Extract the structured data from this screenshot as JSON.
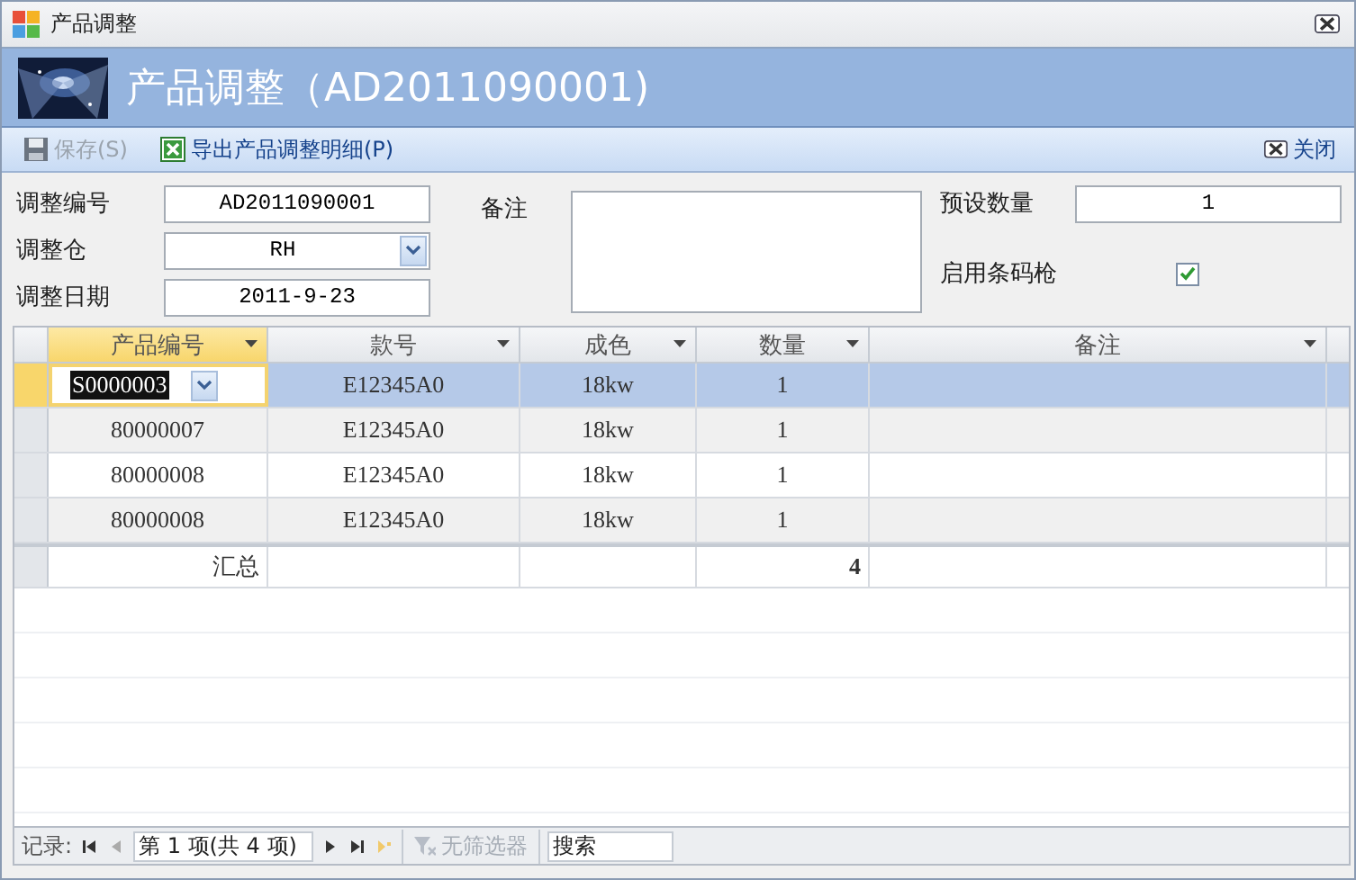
{
  "window": {
    "title": "产品调整"
  },
  "header": {
    "title": "产品调整（AD2011090001)"
  },
  "toolbar": {
    "buttons": [
      {
        "kind": "save",
        "label": "保存(S)",
        "disabled": true
      },
      {
        "kind": "export",
        "label": "导出产品调整明细(P)",
        "disabled": false
      },
      {
        "kind": "close",
        "label": "关闭",
        "disabled": false
      }
    ]
  },
  "form": {
    "number": {
      "label": "调整编号",
      "value": "AD2011090001"
    },
    "warehouse": {
      "label": "调整仓",
      "value": "RH"
    },
    "date": {
      "label": "调整日期",
      "value": "2011-9-23"
    },
    "note": {
      "label": "备注"
    },
    "preset_qty": {
      "label": "预设数量",
      "value": "1"
    },
    "barcode": {
      "label": "启用条码枪",
      "checked": true
    }
  },
  "table": {
    "columns": [
      {
        "label": "产品编号",
        "selected": true
      },
      {
        "label": "款号",
        "selected": false
      },
      {
        "label": "成色",
        "selected": false
      },
      {
        "label": "数量",
        "selected": false
      },
      {
        "label": "备注",
        "selected": false
      }
    ],
    "rows": [
      {
        "selected": true,
        "cells": [
          "S0000003",
          "E12345A0",
          "18kw",
          "1",
          ""
        ]
      },
      {
        "selected": false,
        "cells": [
          "80000007",
          "E12345A0",
          "18kw",
          "1",
          ""
        ]
      },
      {
        "selected": false,
        "cells": [
          "80000008",
          "E12345A0",
          "18kw",
          "1",
          ""
        ]
      },
      {
        "selected": false,
        "cells": [
          "80000008",
          "E12345A0",
          "18kw",
          "1",
          ""
        ]
      }
    ],
    "total": {
      "label": "汇总",
      "quantity": "4"
    }
  },
  "navigator": {
    "label": "记录:",
    "position": "第 1 项(共 4 项)",
    "filter": "无筛选器",
    "search_placeholder": "搜索"
  }
}
